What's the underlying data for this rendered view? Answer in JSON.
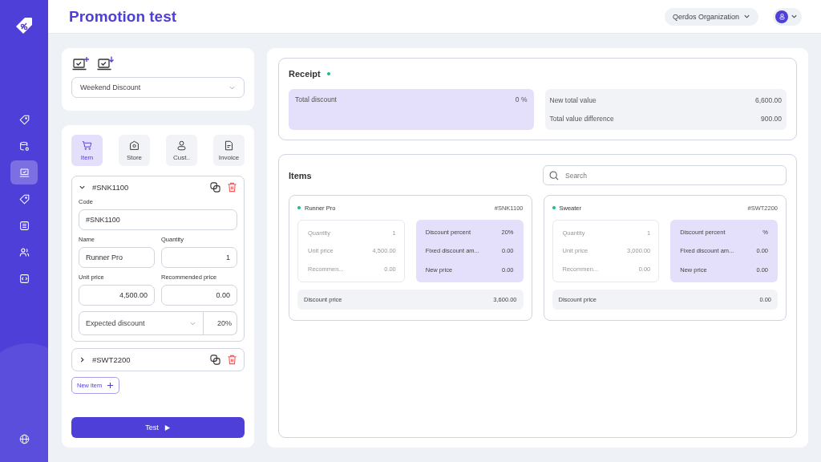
{
  "header": {
    "title": "Promotion test",
    "organization": "Qerdos Organization"
  },
  "sidebar": {
    "nav_items": [
      {
        "selected": false
      },
      {
        "selected": false
      },
      {
        "selected": true
      },
      {
        "selected": false
      },
      {
        "selected": false
      },
      {
        "selected": false
      },
      {
        "selected": false
      }
    ]
  },
  "promotion": {
    "selected": "Weekend Discount"
  },
  "condition_tabs": [
    {
      "label": "Item",
      "selected": true
    },
    {
      "label": "Store",
      "selected": false
    },
    {
      "label": "Cust..",
      "selected": false
    },
    {
      "label": "Invoice",
      "selected": false
    }
  ],
  "item_entries": [
    {
      "code": "#SNK1100",
      "expanded": true,
      "form": {
        "code": {
          "label": "Code",
          "value": "#SNK1100"
        },
        "name": {
          "label": "Name",
          "value": "Runner Pro"
        },
        "quantity": {
          "label": "Quantity",
          "value": "1"
        },
        "unit_price": {
          "label": "Unit price",
          "value": "4,500.00"
        },
        "recommended_price": {
          "label": "Recommended price",
          "value": "0.00"
        },
        "discount_type": "Expected discount",
        "discount_value": "20%"
      }
    },
    {
      "code": "#SWT2200",
      "expanded": false
    }
  ],
  "new_item_button": "New item",
  "test_button": "Test",
  "receipt": {
    "title": "Receipt",
    "total_discount": {
      "label": "Total discount",
      "value": "0 %"
    },
    "totals": [
      {
        "label": "New total value",
        "value": "6,600.00"
      },
      {
        "label": "Total value difference",
        "value": "900.00"
      }
    ]
  },
  "items_panel": {
    "title": "Items",
    "search": {
      "placeholder": "Search"
    },
    "products": [
      {
        "name": "Runner Pro",
        "code": "#SNK1100",
        "details": [
          {
            "label": "Quantity",
            "value": "1"
          },
          {
            "label": "Unit price",
            "value": "4,500.00"
          },
          {
            "label": "Recommen...",
            "value": "0.00"
          }
        ],
        "discounts": [
          {
            "label": "Discount percent",
            "value": "20%"
          },
          {
            "label": "Fixed discount am...",
            "value": "0.00"
          },
          {
            "label": "New price",
            "value": "0.00"
          }
        ],
        "discount_price": {
          "label": "Discount price",
          "value": "3,600.00"
        }
      },
      {
        "name": "Sweater",
        "code": "#SWT2200",
        "details": [
          {
            "label": "Quantity",
            "value": "1"
          },
          {
            "label": "Unit price",
            "value": "3,000.00"
          },
          {
            "label": "Recommen...",
            "value": "0.00"
          }
        ],
        "discounts": [
          {
            "label": "Discount percent",
            "value": "%"
          },
          {
            "label": "Fixed discount am...",
            "value": "0.00"
          },
          {
            "label": "New price",
            "value": "0.00"
          }
        ],
        "discount_price": {
          "label": "Discount price",
          "value": "0.00"
        }
      }
    ]
  }
}
